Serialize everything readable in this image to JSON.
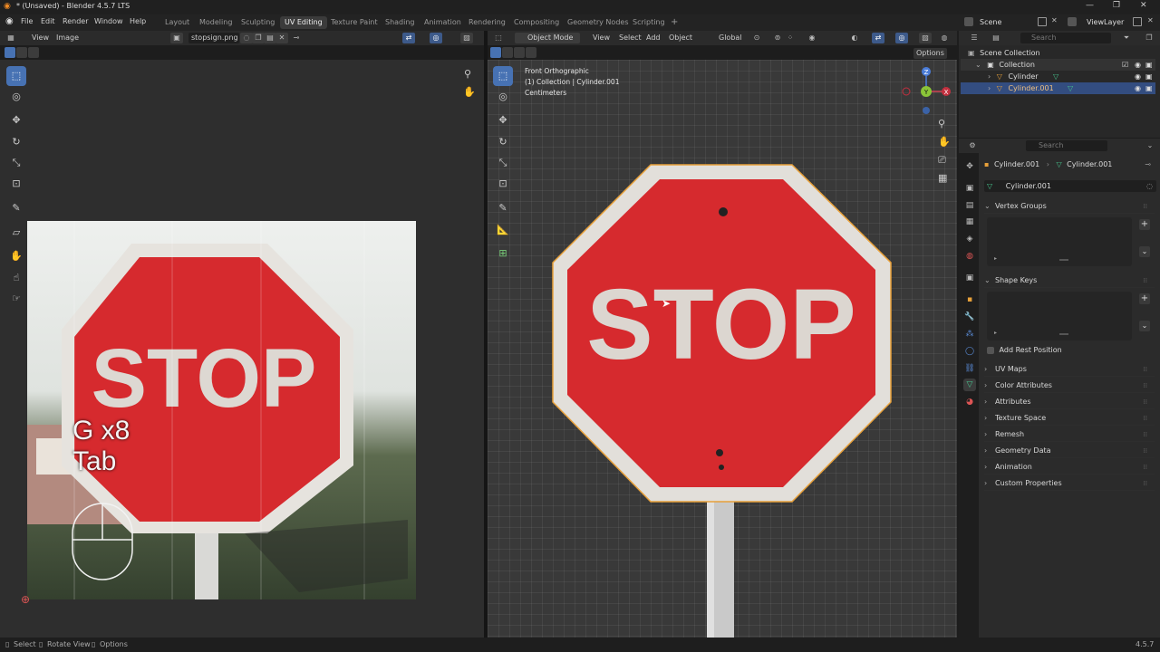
{
  "window": {
    "title": "* (Unsaved) - Blender 4.5.7 LTS"
  },
  "menus": [
    "File",
    "Edit",
    "Render",
    "Window",
    "Help"
  ],
  "workspaces": {
    "tabs": [
      "Layout",
      "Modeling",
      "Sculpting",
      "UV Editing",
      "Texture Paint",
      "Shading",
      "Animation",
      "Rendering",
      "Compositing",
      "Geometry Nodes",
      "Scripting"
    ],
    "active": "UV Editing",
    "add": "+"
  },
  "scene": {
    "name": "Scene",
    "view_layer": "ViewLayer"
  },
  "uv_editor": {
    "view_menu": "View",
    "image_menu": "Image",
    "image_name": "stopsign.png",
    "overlay_text": [
      "G x8",
      "Tab"
    ],
    "image_sign_text": "STOP"
  },
  "viewport": {
    "mode": "Object Mode",
    "menus": [
      "View",
      "Select",
      "Add",
      "Object"
    ],
    "orientation": "Global",
    "options": "Options",
    "info": [
      "Front Orthographic",
      "(1) Collection | Cylinder.001",
      "Centimeters"
    ],
    "sign_text": "STOP",
    "gizmo": {
      "z": "Z",
      "y": "Y",
      "x": "X"
    }
  },
  "outliner": {
    "search_placeholder": "Search",
    "items": [
      {
        "label": "Scene Collection"
      },
      {
        "label": "Collection"
      },
      {
        "label": "Cylinder"
      },
      {
        "label": "Cylinder.001"
      }
    ]
  },
  "properties": {
    "search_placeholder": "Search",
    "breadcrumb": [
      "Cylinder.001",
      "Cylinder.001"
    ],
    "datablock": "Cylinder.001",
    "panels": {
      "vertex_groups": "Vertex Groups",
      "shape_keys": "Shape Keys",
      "add_rest_position": "Add Rest Position",
      "collapsed": [
        "UV Maps",
        "Color Attributes",
        "Attributes",
        "Texture Space",
        "Remesh",
        "Geometry Data",
        "Animation",
        "Custom Properties"
      ]
    }
  },
  "statusbar": {
    "items": [
      "Select",
      "Rotate View",
      "Options"
    ],
    "version": "4.5.7"
  },
  "colors": {
    "accent": "#4772b3",
    "sign_red": "#d62a2e",
    "selection_outline": "#e8a13a",
    "active_tab": "#3b3b3b"
  }
}
